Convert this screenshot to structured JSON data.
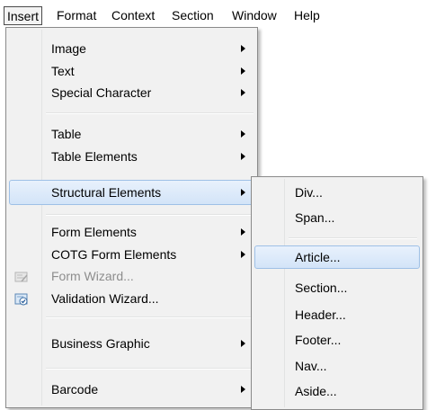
{
  "menubar": {
    "items": [
      "Insert",
      "Format",
      "Context",
      "Section",
      "Window",
      "Help"
    ],
    "active_index": 0
  },
  "insert_menu": {
    "items": [
      {
        "label": "Image",
        "submenu": true
      },
      {
        "label": "Text",
        "submenu": true
      },
      {
        "label": "Special Character",
        "submenu": true
      },
      {
        "label": "Table",
        "submenu": true
      },
      {
        "label": "Table Elements",
        "submenu": true
      },
      {
        "label": "Structural Elements",
        "submenu": true,
        "highlighted": true
      },
      {
        "label": "Form Elements",
        "submenu": true
      },
      {
        "label": "COTG Form Elements",
        "submenu": true
      },
      {
        "label": "Form Wizard...",
        "disabled": true,
        "icon": "form-wizard-icon"
      },
      {
        "label": "Validation Wizard...",
        "icon": "validation-wizard-icon"
      },
      {
        "label": "Business Graphic",
        "submenu": true
      },
      {
        "label": "Barcode",
        "submenu": true
      }
    ]
  },
  "structural_submenu": {
    "items": [
      {
        "label": "Div..."
      },
      {
        "label": "Span..."
      },
      {
        "label": "Article...",
        "highlighted": true
      },
      {
        "label": "Section..."
      },
      {
        "label": "Header..."
      },
      {
        "label": "Footer..."
      },
      {
        "label": "Nav..."
      },
      {
        "label": "Aside..."
      }
    ]
  },
  "colors": {
    "highlight_border": "#9ec0e6",
    "highlight_fill": "#d3e4f8",
    "menu_bg": "#f1f1f1",
    "disabled_text": "#8d8d8d"
  }
}
